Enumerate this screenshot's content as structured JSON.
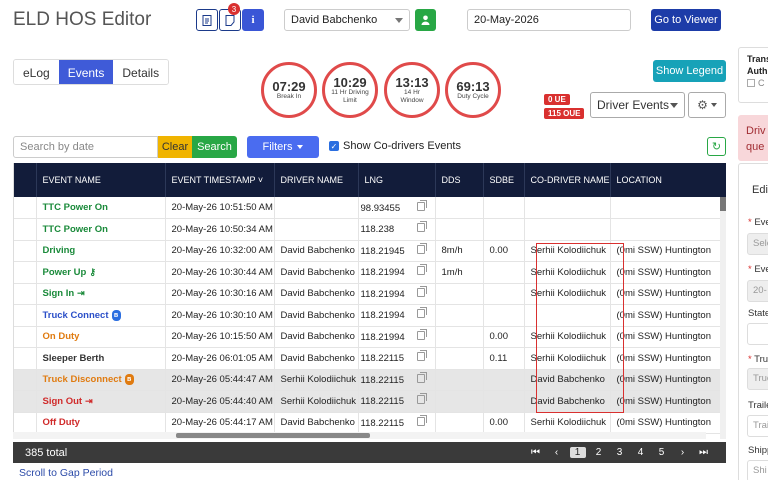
{
  "app": {
    "title": "ELD HOS Editor"
  },
  "toolbar": {
    "notes_badge": "3",
    "info_label": "i",
    "driver_selected": "David Babchenko",
    "date_value": "20-May-2026",
    "go_viewer_label": "Go to Viewer"
  },
  "tabs": [
    {
      "label": "eLog",
      "active": false
    },
    {
      "label": "Events",
      "active": true
    },
    {
      "label": "Details",
      "active": false
    }
  ],
  "gauges": [
    {
      "value": "07:29",
      "label": "Break In"
    },
    {
      "value": "10:29",
      "label": "11 Hr Driving Limit"
    },
    {
      "value": "13:13",
      "label": "14 Hr Window"
    },
    {
      "value": "69:13",
      "label": "Duty Cycle"
    }
  ],
  "legend_button": "Show Legend",
  "ue_badges": {
    "ue": "0 UE",
    "oue": "115 OUE"
  },
  "driver_events_select": "Driver Events",
  "search": {
    "placeholder": "Search by date",
    "clear_label": "Clear",
    "search_label": "Search"
  },
  "filters_label": "Filters",
  "codrivers_label": "Show Co-drivers Events",
  "columns": [
    "EVENT NAME",
    "EVENT TIMESTAMP ˅",
    "DRIVER NAME",
    "LNG",
    "DDS",
    "SDBE",
    "CO-DRIVER NAME",
    "LOCATION"
  ],
  "rows": [
    {
      "event": "TTC Power On",
      "color": "#1a8a3a",
      "icon": "",
      "timestamp": "20-May-26 10:51:50 AM",
      "driver": "",
      "lng": "98.93455",
      "dds": "",
      "sdbe": "",
      "codriver": "",
      "location": "",
      "grey": false
    },
    {
      "event": "TTC Power On",
      "color": "#1a8a3a",
      "icon": "",
      "timestamp": "20-May-26 10:50:34 AM",
      "driver": "",
      "lng": "118.238",
      "dds": "",
      "sdbe": "",
      "codriver": "",
      "location": "",
      "grey": false
    },
    {
      "event": "Driving",
      "color": "#1a8a3a",
      "icon": "",
      "timestamp": "20-May-26 10:32:00 AM",
      "driver": "David Babchenko",
      "lng": "118.21945",
      "dds": "8m/h",
      "sdbe": "0.00",
      "codriver": "Serhii Kolodiichuk",
      "location": "(0mi SSW) Huntington",
      "grey": false
    },
    {
      "event": "Power Up",
      "color": "#1a8a3a",
      "icon": "key",
      "timestamp": "20-May-26 10:30:44 AM",
      "driver": "David Babchenko",
      "lng": "118.21994",
      "dds": "1m/h",
      "sdbe": "",
      "codriver": "Serhii Kolodiichuk",
      "location": "(0mi SSW) Huntington",
      "grey": false
    },
    {
      "event": "Sign In",
      "color": "#1a8a3a",
      "icon": "signin",
      "timestamp": "20-May-26 10:30:16 AM",
      "driver": "David Babchenko",
      "lng": "118.21994",
      "dds": "",
      "sdbe": "",
      "codriver": "Serhii Kolodiichuk",
      "location": "(0mi SSW) Huntington",
      "grey": false
    },
    {
      "event": "Truck Connect",
      "color": "#2b4fc8",
      "icon": "bt-blue",
      "timestamp": "20-May-26 10:30:10 AM",
      "driver": "David Babchenko",
      "lng": "118.21994",
      "dds": "",
      "sdbe": "",
      "codriver": "",
      "location": "(0mi SSW) Huntington",
      "grey": false
    },
    {
      "event": "On Duty",
      "color": "#e07b10",
      "icon": "",
      "timestamp": "20-May-26 10:15:50 AM",
      "driver": "David Babchenko",
      "lng": "118.21994",
      "dds": "",
      "sdbe": "0.00",
      "codriver": "Serhii Kolodiichuk",
      "location": "(0mi SSW) Huntington",
      "grey": false
    },
    {
      "event": "Sleeper Berth",
      "color": "#333333",
      "icon": "",
      "timestamp": "20-May-26 06:01:05 AM",
      "driver": "David Babchenko",
      "lng": "118.22115",
      "dds": "",
      "sdbe": "0.11",
      "codriver": "Serhii Kolodiichuk",
      "location": "(0mi SSW) Huntington",
      "grey": false
    },
    {
      "event": "Truck Disconnect",
      "color": "#e07b10",
      "icon": "bt-orange",
      "timestamp": "20-May-26 05:44:47 AM",
      "driver": "Serhii Kolodiichuk",
      "lng": "118.22115",
      "dds": "",
      "sdbe": "",
      "codriver": "David Babchenko",
      "location": "(0mi SSW) Huntington",
      "grey": true
    },
    {
      "event": "Sign Out",
      "color": "#d02a2a",
      "icon": "signout",
      "timestamp": "20-May-26 05:44:40 AM",
      "driver": "Serhii Kolodiichuk",
      "lng": "118.22115",
      "dds": "",
      "sdbe": "",
      "codriver": "David Babchenko",
      "location": "(0mi SSW) Huntington",
      "grey": true
    },
    {
      "event": "Off Duty",
      "color": "#d02a2a",
      "icon": "",
      "timestamp": "20-May-26 05:44:17 AM",
      "driver": "David Babchenko",
      "lng": "118.22115",
      "dds": "",
      "sdbe": "0.00",
      "codriver": "Serhii Kolodiichuk",
      "location": "(0mi SSW) Huntington",
      "grey": false
    }
  ],
  "footer": {
    "total": "385 total",
    "pages": [
      "1",
      "2",
      "3",
      "4",
      "5"
    ],
    "current_page": "1",
    "nav_first": "⏮",
    "nav_prev": "‹",
    "nav_next": "›",
    "nav_last": "⏭"
  },
  "gap_link": "Scroll to Gap Period",
  "right_panel": {
    "box_line1": "Trans",
    "box_line2": "Auth",
    "box_line3": "C",
    "alert_line1": "Driv",
    "alert_line2": "que",
    "edit_header": "Edi",
    "fields": [
      {
        "label": "Eve",
        "required": true,
        "value": "Sele"
      },
      {
        "label": "Eve",
        "required": true,
        "value": "20-"
      },
      {
        "label": "State",
        "required": false,
        "value": ""
      },
      {
        "label": "Truc",
        "required": true,
        "value": "Truc"
      },
      {
        "label": "Traile",
        "required": false,
        "value": "Trai"
      },
      {
        "label": "Shipp",
        "required": false,
        "value": "Shi"
      }
    ]
  }
}
